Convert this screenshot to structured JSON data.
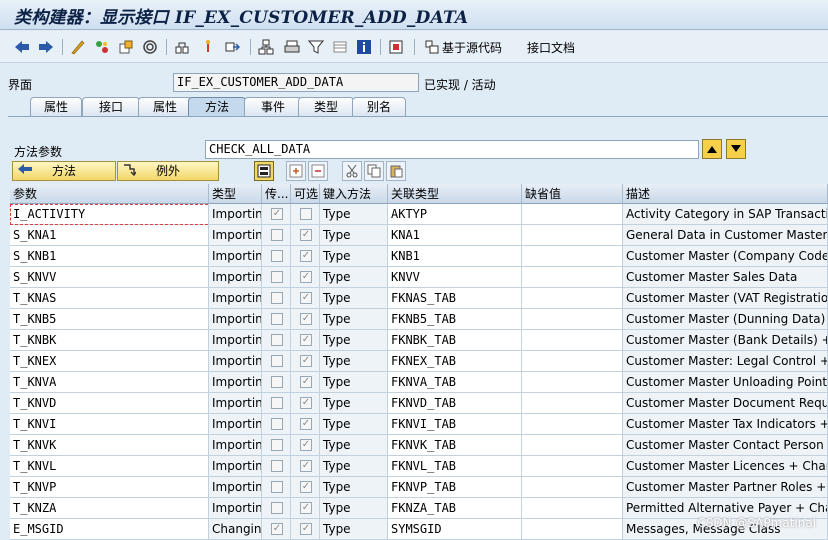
{
  "title": "类构建器：显示接口 IF_EX_CUSTOMER_ADD_DATA",
  "toolbar": {
    "source_based_label": "基于源代码",
    "interface_doc_label": "接口文档",
    "icons": [
      "back-arrow-icon",
      "forward-arrow-icon",
      "display-change-icon",
      "check-icon",
      "activate-icon",
      "test-icon",
      "where-used-icon",
      "object-list-icon",
      "navigate-icon",
      "hierarchy-icon",
      "print-icon",
      "filter-icon",
      "layout-icon",
      "info-icon",
      "enhance-icon"
    ]
  },
  "interface": {
    "label": "界面",
    "name": "IF_EX_CUSTOMER_ADD_DATA",
    "status": "已实现 / 活动"
  },
  "tabs": [
    {
      "label": "属性",
      "active": false
    },
    {
      "label": "接口",
      "active": false
    },
    {
      "label": "属性",
      "active": false
    },
    {
      "label": "方法",
      "active": true
    },
    {
      "label": "事件",
      "active": false
    },
    {
      "label": "类型",
      "active": false
    },
    {
      "label": "别名",
      "active": false
    }
  ],
  "method_param": {
    "label": "方法参数",
    "value": "CHECK_ALL_DATA"
  },
  "buttons": {
    "methods": "方法",
    "exceptions": "例外"
  },
  "table": {
    "columns": [
      "参数",
      "类型",
      "传...",
      "可选",
      "键入方法",
      "关联类型",
      "缺省值",
      "描述"
    ],
    "rows": [
      {
        "param": "I_ACTIVITY",
        "type": "Importin…",
        "pass": true,
        "optional": false,
        "typing": "Type",
        "assoc": "AKTYP",
        "default": "",
        "desc": "Activity Category in SAP Transaction"
      },
      {
        "param": "S_KNA1",
        "type": "Importin…",
        "pass": false,
        "optional": true,
        "typing": "Type",
        "assoc": "KNA1",
        "default": "",
        "desc": "General Data in Customer Master"
      },
      {
        "param": "S_KNB1",
        "type": "Importin…",
        "pass": false,
        "optional": true,
        "typing": "Type",
        "assoc": "KNB1",
        "default": "",
        "desc": "Customer Master (Company Code)"
      },
      {
        "param": "S_KNVV",
        "type": "Importin…",
        "pass": false,
        "optional": true,
        "typing": "Type",
        "assoc": "KNVV",
        "default": "",
        "desc": "Customer Master Sales Data"
      },
      {
        "param": "T_KNAS",
        "type": "Importin…",
        "pass": false,
        "optional": true,
        "typing": "Type",
        "assoc": "FKNAS_TAB",
        "default": "",
        "desc": "Customer Master (VAT Registration …"
      },
      {
        "param": "T_KNB5",
        "type": "Importin…",
        "pass": false,
        "optional": true,
        "typing": "Type",
        "assoc": "FKNB5_TAB",
        "default": "",
        "desc": "Customer Master (Dunning Data) + …"
      },
      {
        "param": "T_KNBK",
        "type": "Importin…",
        "pass": false,
        "optional": true,
        "typing": "Type",
        "assoc": "FKNBK_TAB",
        "default": "",
        "desc": "Customer Master (Bank Details) + C…"
      },
      {
        "param": "T_KNEX",
        "type": "Importin…",
        "pass": false,
        "optional": true,
        "typing": "Type",
        "assoc": "FKNEX_TAB",
        "default": "",
        "desc": "Customer Master: Legal Control + C…"
      },
      {
        "param": "T_KNVA",
        "type": "Importin…",
        "pass": false,
        "optional": true,
        "typing": "Type",
        "assoc": "FKNVA_TAB",
        "default": "",
        "desc": "Customer Master Unloading Points +…"
      },
      {
        "param": "T_KNVD",
        "type": "Importin…",
        "pass": false,
        "optional": true,
        "typing": "Type",
        "assoc": "FKNVD_TAB",
        "default": "",
        "desc": "Customer Master Document Reques…"
      },
      {
        "param": "T_KNVI",
        "type": "Importin…",
        "pass": false,
        "optional": true,
        "typing": "Type",
        "assoc": "FKNVI_TAB",
        "default": "",
        "desc": "Customer Master Tax Indicators + C…"
      },
      {
        "param": "T_KNVK",
        "type": "Importin…",
        "pass": false,
        "optional": true,
        "typing": "Type",
        "assoc": "FKNVK_TAB",
        "default": "",
        "desc": "Customer Master Contact Person + …"
      },
      {
        "param": "T_KNVL",
        "type": "Importin…",
        "pass": false,
        "optional": true,
        "typing": "Type",
        "assoc": "FKNVL_TAB",
        "default": "",
        "desc": "Customer Master Licences + Chang…"
      },
      {
        "param": "T_KNVP",
        "type": "Importin…",
        "pass": false,
        "optional": true,
        "typing": "Type",
        "assoc": "FKNVP_TAB",
        "default": "",
        "desc": "Customer Master Partner Roles + Ch…"
      },
      {
        "param": "T_KNZA",
        "type": "Importin…",
        "pass": false,
        "optional": true,
        "typing": "Type",
        "assoc": "FKNZA_TAB",
        "default": "",
        "desc": "Permitted Alternative Payer + Chan…"
      },
      {
        "param": "E_MSGID",
        "type": "Changing",
        "pass": true,
        "optional": true,
        "typing": "Type",
        "assoc": "SYMSGID",
        "default": "",
        "desc": "Messages, Message Class"
      }
    ]
  },
  "watermark": "CSDN @SAPmatinal",
  "colors": {
    "accent_yellow": "#f1d768",
    "title_blue": "#0b2246",
    "bg": "#dfebf5"
  }
}
